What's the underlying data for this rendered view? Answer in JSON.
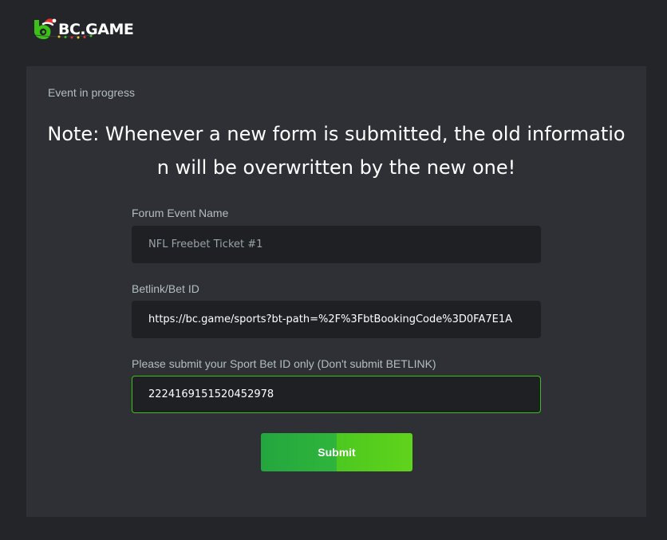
{
  "brand": {
    "name": "BC.GAME",
    "logo_icon": "bc-game-logo-icon",
    "accent": "#3bc117"
  },
  "panel": {
    "status_text": "Event in progress",
    "note": "Note: Whenever a new form is submitted, the old information will be overwritten by the new one!"
  },
  "form": {
    "event_name": {
      "label": "Forum Event Name",
      "value": "NFL Freebet Ticket #1"
    },
    "betlink": {
      "label": "Betlink/Bet ID",
      "value": "https://bc.game/sports?bt-path=%2F%3FbtBookingCode%3D0FA7E1A"
    },
    "sport_bet_id": {
      "label": "Please submit your Sport Bet ID only (Don't submit BETLINK)",
      "value": "2224169151520452978"
    },
    "submit_label": "Submit"
  }
}
